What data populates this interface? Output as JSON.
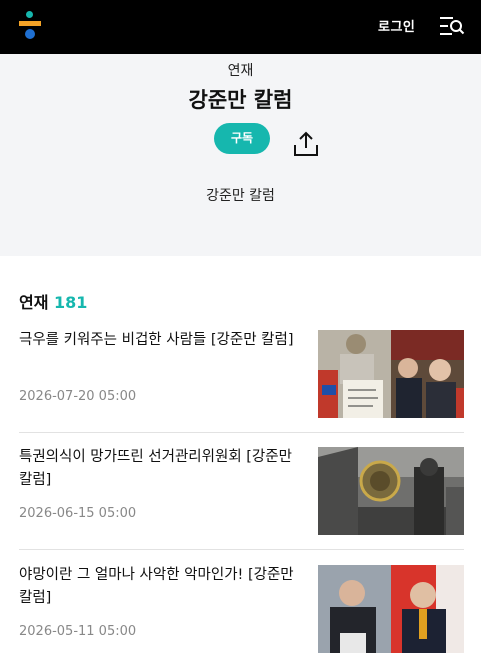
{
  "header": {
    "login_label": "로그인",
    "icons": {
      "logo": "brand-logo",
      "menu": "menu-search-icon"
    },
    "colors": {
      "bar": "#000000",
      "logo_teal": "#16b7ae",
      "logo_orange": "#f4a327",
      "logo_blue": "#1f6fd1"
    }
  },
  "hero": {
    "label": "연재",
    "title": "강준만 칼럼",
    "subscribe_label": "구독",
    "share_icon": "share-icon",
    "description": "강준만 칼럼",
    "accent": "#16b7ae"
  },
  "list": {
    "heading": "연재",
    "count": "181",
    "items": [
      {
        "title": "극우를 키워주는 비겁한 사람들 [강준만 칼럼]",
        "date": "2026-07-20 05:00",
        "thumb": "protest-photo"
      },
      {
        "title": "특권의식이 망가뜨린 선거관리위원회 [강준만 칼럼]",
        "date": "2026-06-15 05:00",
        "thumb": "court-emblem-photo"
      },
      {
        "title": "야망이란 그 얼마나 사악한 악마인가! [강준만 칼럼]",
        "date": "2026-05-11 05:00",
        "thumb": "politicians-photo"
      }
    ]
  }
}
